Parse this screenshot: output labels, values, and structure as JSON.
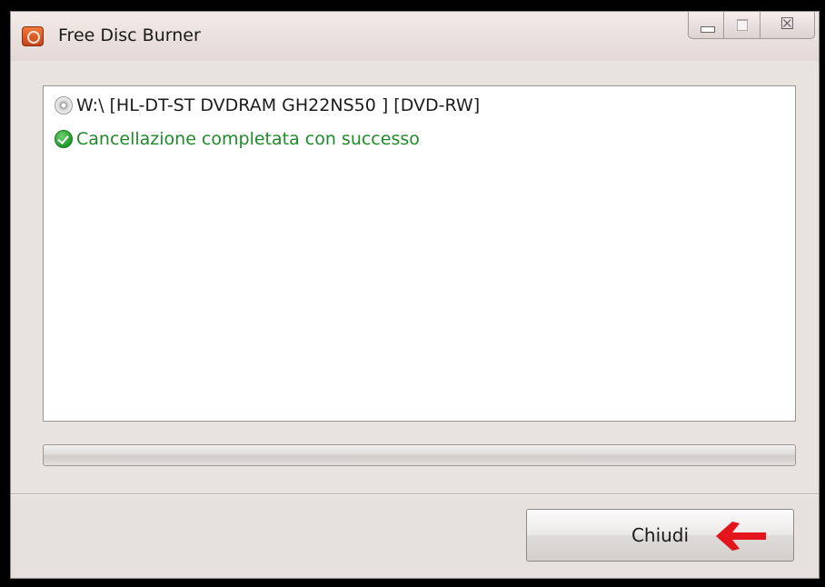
{
  "window": {
    "title": "Free Disc Burner",
    "close_glyph": "☒"
  },
  "log": {
    "lines": [
      {
        "icon": "disc-icon",
        "text": "W:\\ [HL-DT-ST DVDRAM GH22NS50 ]  [DVD-RW]"
      },
      {
        "icon": "check-icon",
        "text": "Cancellazione completata con successo"
      }
    ]
  },
  "progress": {
    "value": 0
  },
  "footer": {
    "close_label": "Chiudi"
  },
  "colors": {
    "success_text": "#1f8a2a",
    "annotation_arrow": "#e3141b"
  },
  "icons": [
    "app-icon",
    "minimize-icon",
    "maximize-icon",
    "close-icon",
    "disc-icon",
    "check-icon",
    "red-arrow-icon"
  ]
}
